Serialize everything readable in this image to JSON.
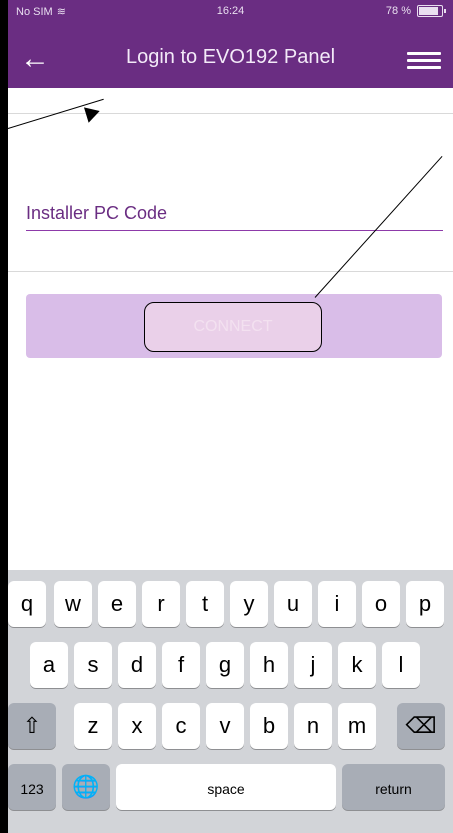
{
  "status": {
    "carrier": "No SIM",
    "time": "16:24",
    "battery": "78 %"
  },
  "header": {
    "title": "Login to EVO192 Panel",
    "back_icon": "←"
  },
  "form": {
    "placeholder": "Installer PC Code",
    "value": ""
  },
  "button": {
    "connect_label": "CONNECT"
  },
  "keyboard": {
    "row1": [
      "q",
      "w",
      "e",
      "r",
      "t",
      "y",
      "u",
      "i",
      "o",
      "p"
    ],
    "row2": [
      "a",
      "s",
      "d",
      "f",
      "g",
      "h",
      "j",
      "k",
      "l"
    ],
    "row3": [
      "z",
      "x",
      "c",
      "v",
      "b",
      "n",
      "m"
    ],
    "row4": {
      "numbers": "123",
      "space": "space",
      "return": "return"
    }
  }
}
